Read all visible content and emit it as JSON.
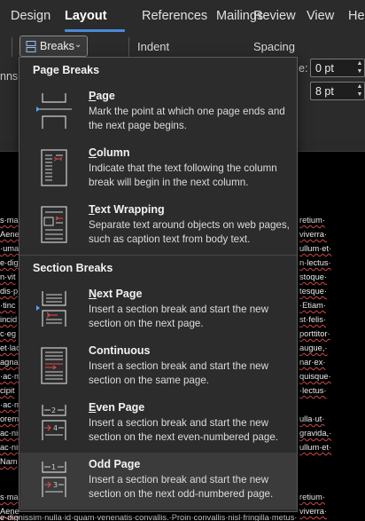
{
  "ribbon_tabs": [
    {
      "label": "Design"
    },
    {
      "label": "Layout"
    },
    {
      "label": "References"
    },
    {
      "label": "Mailings"
    },
    {
      "label": "Review"
    },
    {
      "label": "View"
    },
    {
      "label": "Hel"
    }
  ],
  "active_tab": "Layout",
  "ribbon": {
    "breaks_label": "Breaks",
    "indent_label": "Indent",
    "spacing_label": "Spacing",
    "left_partial": "nns",
    "spacing_before_prefix": "e:",
    "spacing_before_value": "0 pt",
    "spacing_after_value": "8 pt"
  },
  "menu": {
    "page_breaks_heading": "Page Breaks",
    "section_breaks_heading": "Section Breaks",
    "items": [
      {
        "title_key": "P",
        "title_rest": "age",
        "desc": "Mark the point at which one page ends and the next page begins.",
        "icon": "page-break-icon"
      },
      {
        "title_key": "C",
        "title_rest": "olumn",
        "desc": "Indicate that the text following the column break will begin in the next column.",
        "icon": "column-break-icon"
      },
      {
        "title_key": "T",
        "title_rest": "ext Wrapping",
        "desc": "Separate text around objects on web pages, such as caption text from body text.",
        "icon": "text-wrapping-icon"
      },
      {
        "title_key": "N",
        "title_rest": "ext Page",
        "desc": "Insert a section break and start the new section on the next page.",
        "icon": "next-page-icon"
      },
      {
        "title_key": "",
        "title_rest": "Continuous",
        "desc": "Insert a section break and start the new section on the same page.",
        "icon": "continuous-icon"
      },
      {
        "title_key": "E",
        "title_rest": "ven Page",
        "desc": "Insert a section break and start the new section on the next even-numbered page.",
        "icon": "even-page-icon"
      },
      {
        "title_key": "",
        "title_rest": "Odd Page",
        "desc": "Insert a section break and start the new section on the next odd-numbered page.",
        "icon": "odd-page-icon"
      }
    ]
  },
  "document_left": [
    "s·ma",
    "Aene",
    "·uma",
    "e·dig",
    "n·vit",
    "dis·p",
    "·tinc",
    "incid",
    "c·eg",
    "et·lac",
    "agna",
    "·ac·m",
    "cipit",
    "·ac·m",
    "orem",
    "ac·nis",
    "ac·nis",
    "Nam",
    "s·ma",
    "Aene"
  ],
  "document_right": [
    "retium·",
    "viverra·",
    "ullum·et·",
    "n·lectus·",
    "stoque·",
    "tesque·",
    "·Etiam·",
    "st·felis·",
    "porttitor·",
    "augue,·",
    "nar·ex·",
    "quisque·",
    "·lectus·",
    "ulla·ut·",
    "gravida,·",
    "ullum·et·",
    "retium·",
    "viverra·"
  ],
  "document_bottom_line": "e·dignissim·nulla·id·quam·venenatis·convallis.·Proin·convallis·nisl·fringilla·metus·"
}
